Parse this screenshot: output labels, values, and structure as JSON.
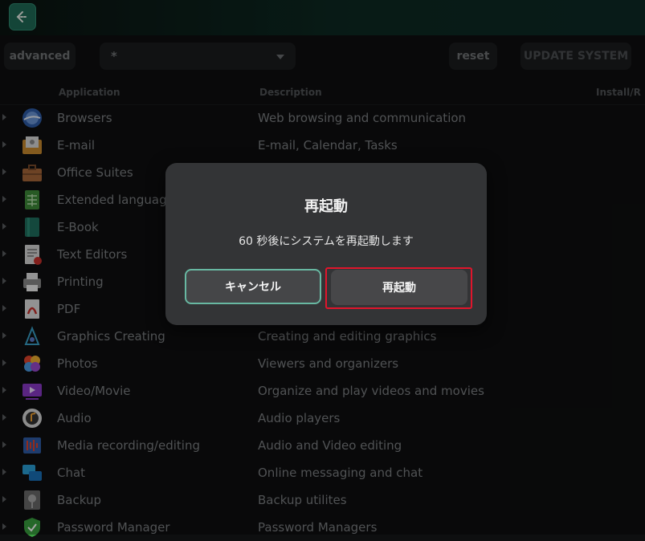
{
  "toolbar": {
    "advanced_label": "advanced",
    "filter_value": "*",
    "reset_label": "reset",
    "update_label": "UPDATE SYSTEM"
  },
  "columns": {
    "application": "Application",
    "description": "Description",
    "install": "Install/R"
  },
  "rows": [
    {
      "app": "Browsers",
      "desc": "Web browsing and communication",
      "icon": "browser-icon"
    },
    {
      "app": "E-mail",
      "desc": "E-mail, Calendar, Tasks",
      "icon": "mail-icon"
    },
    {
      "app": "Office Suites",
      "desc": "",
      "icon": "briefcase-icon"
    },
    {
      "app": "Extended language",
      "desc": "",
      "icon": "spreadsheet-icon"
    },
    {
      "app": "E-Book",
      "desc": "",
      "icon": "book-icon"
    },
    {
      "app": "Text Editors",
      "desc": "",
      "icon": "text-editor-icon"
    },
    {
      "app": "Printing",
      "desc": "",
      "icon": "printer-icon"
    },
    {
      "app": "PDF",
      "desc": "",
      "icon": "pdf-icon"
    },
    {
      "app": "Graphics Creating",
      "desc": "Creating and editing graphics",
      "icon": "graphics-icon"
    },
    {
      "app": "Photos",
      "desc": "Viewers and organizers",
      "icon": "photos-icon"
    },
    {
      "app": "Video/Movie",
      "desc": "Organize and play videos and movies",
      "icon": "video-icon"
    },
    {
      "app": "Audio",
      "desc": "Audio players",
      "icon": "audio-icon"
    },
    {
      "app": "Media recording/editing",
      "desc": "Audio and Video editing",
      "icon": "media-editing-icon"
    },
    {
      "app": "Chat",
      "desc": "Online messaging and chat",
      "icon": "chat-icon"
    },
    {
      "app": "Backup",
      "desc": "Backup utilites",
      "icon": "backup-icon"
    },
    {
      "app": "Password Manager",
      "desc": "Password Managers",
      "icon": "password-icon"
    }
  ],
  "dialog": {
    "title": "再起動",
    "message": "60 秒後にシステムを再起動します",
    "cancel_label": "キャンセル",
    "restart_label": "再起動"
  }
}
